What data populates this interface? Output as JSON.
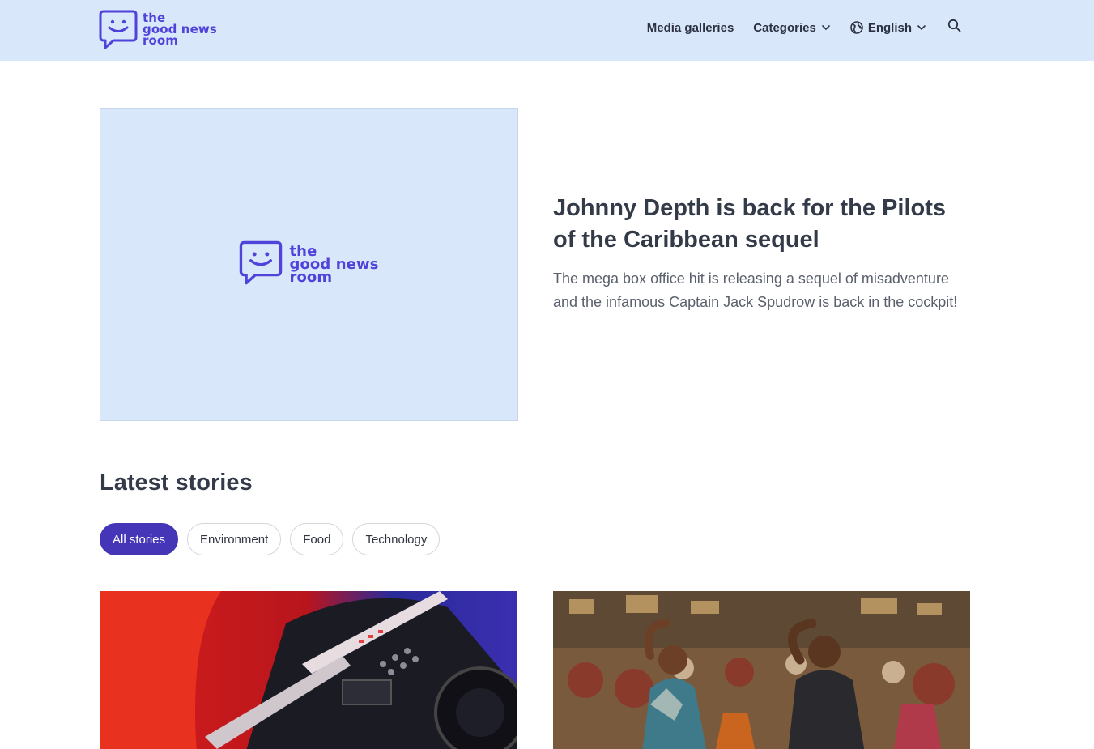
{
  "brand": {
    "logo_line1": "the",
    "logo_line2": "good news",
    "logo_line3": "room",
    "color": "#5043d9"
  },
  "nav": {
    "media_galleries": "Media galleries",
    "categories": "Categories",
    "language": "English",
    "icons": [
      "chevron-down-icon",
      "globe-icon",
      "search-icon"
    ]
  },
  "hero": {
    "title": "Johnny Depth is back for the Pilots of the Caribbean sequel",
    "description": "The mega box office hit is releasing a sequel of misadventure and the infamous Captain Jack Spudrow is back in the cockpit!"
  },
  "latest": {
    "title": "Latest stories",
    "filters": [
      "All stories",
      "Environment",
      "Food",
      "Technology"
    ],
    "active_filter": "All stories"
  },
  "colors": {
    "header_bg": "#d9e7fb",
    "accent": "#4536b8",
    "text": "#333a48"
  }
}
